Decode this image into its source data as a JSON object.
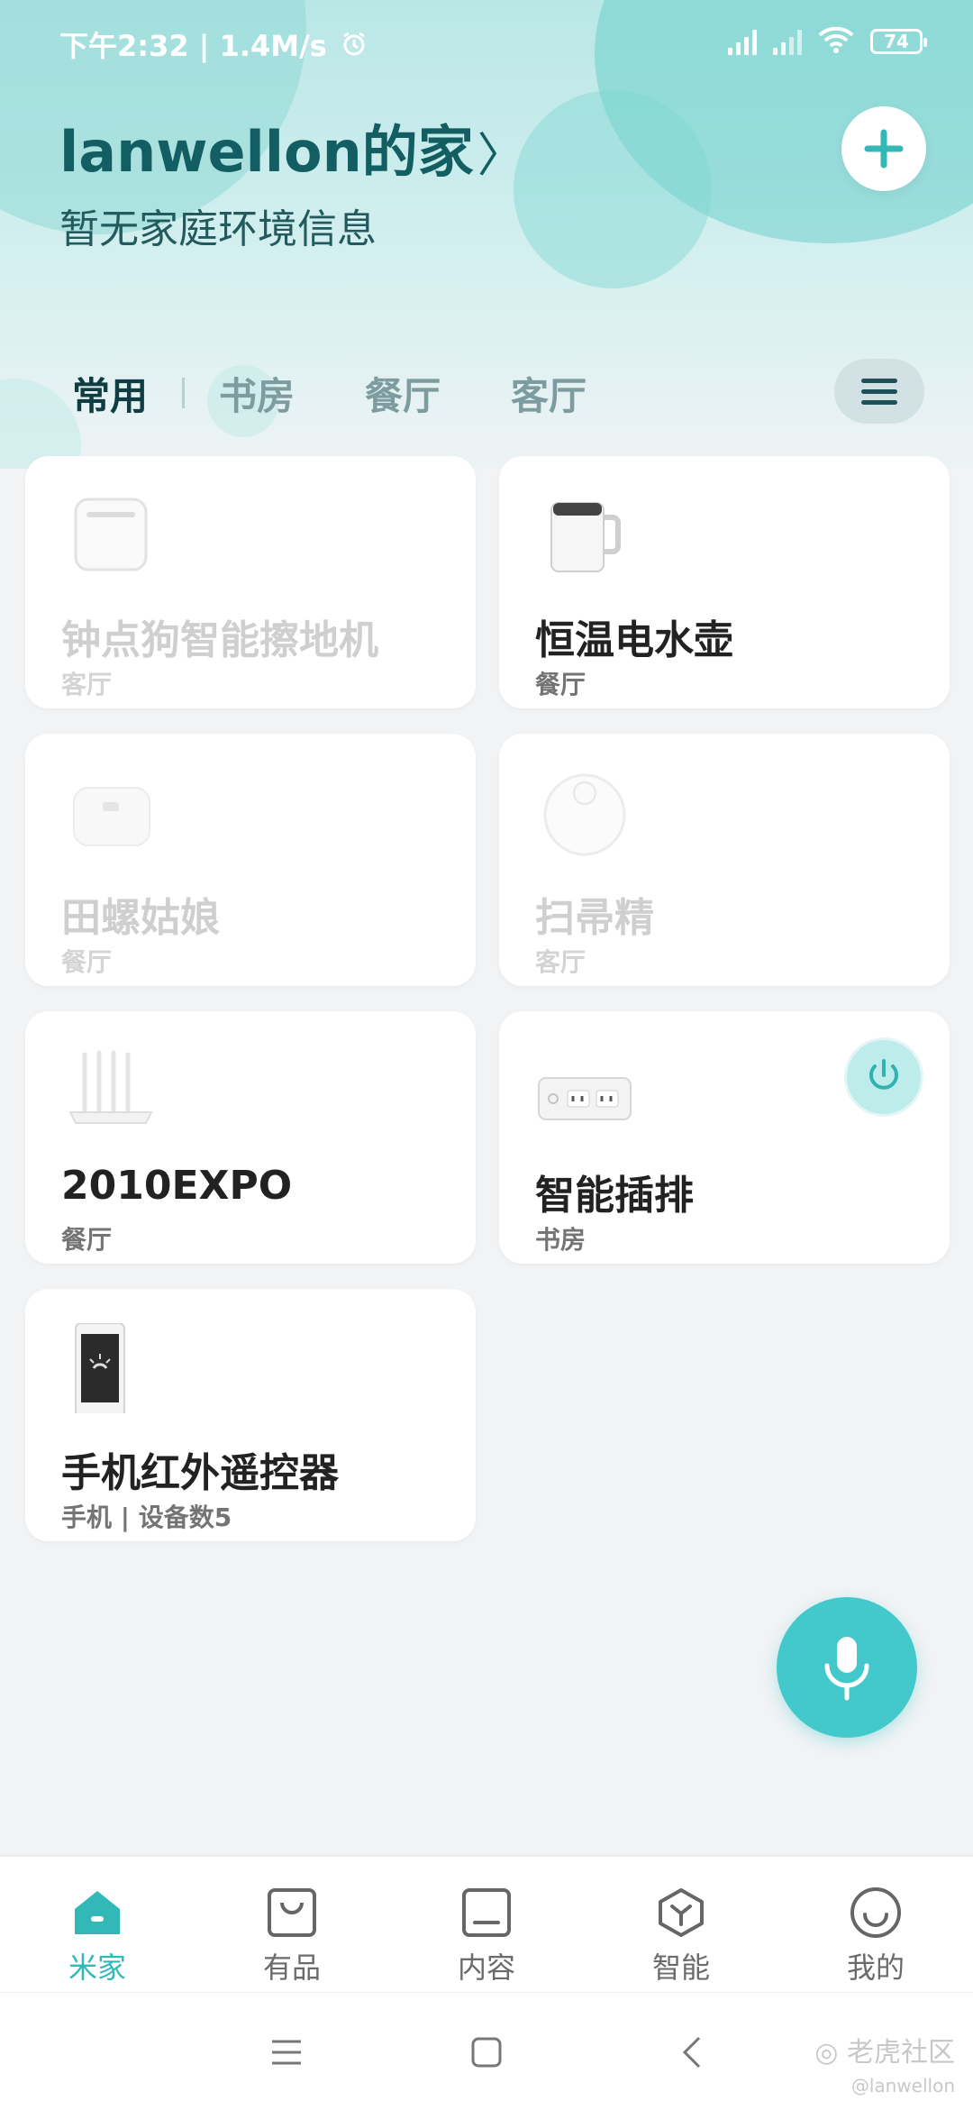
{
  "status_bar": {
    "time_speed": "下午2:32 | 1.4M/s",
    "battery": "74"
  },
  "header": {
    "home_name": "lanwellon的家",
    "chevron": "〉",
    "subtitle": "暂无家庭环境信息"
  },
  "tabs": [
    {
      "label": "常用",
      "active": true
    },
    {
      "label": "书房",
      "active": false
    },
    {
      "label": "餐厅",
      "active": false
    },
    {
      "label": "客厅",
      "active": false
    }
  ],
  "devices": [
    {
      "name": "钟点狗智能擦地机",
      "room": "客厅",
      "online": false,
      "icon": "mop-robot-icon"
    },
    {
      "name": "恒温电水壶",
      "room": "餐厅",
      "online": true,
      "icon": "kettle-icon"
    },
    {
      "name": "田螺姑娘",
      "room": "餐厅",
      "online": false,
      "icon": "rice-cooker-icon"
    },
    {
      "name": "扫帚精",
      "room": "客厅",
      "online": false,
      "icon": "robot-vacuum-icon"
    },
    {
      "name": "2010EXPO",
      "room": "餐厅",
      "online": true,
      "icon": "router-icon"
    },
    {
      "name": "智能插排",
      "room": "书房",
      "online": true,
      "icon": "power-strip-icon"
    },
    {
      "name": "手机红外遥控器",
      "room": "手机 | 设备数5",
      "online": true,
      "icon": "phone-remote-icon"
    }
  ],
  "bottom_nav": [
    {
      "label": "米家",
      "icon": "home-icon",
      "active": true
    },
    {
      "label": "有品",
      "icon": "shopping-bag-icon",
      "active": false
    },
    {
      "label": "内容",
      "icon": "content-icon",
      "active": false
    },
    {
      "label": "智能",
      "icon": "smart-cube-icon",
      "active": false
    },
    {
      "label": "我的",
      "icon": "profile-smile-icon",
      "active": false
    }
  ],
  "watermark": {
    "text": "老虎社区",
    "sub": "@lanwellon"
  },
  "colors": {
    "accent": "#43c9cb",
    "title": "#125e62",
    "nav_active": "#33b8b8"
  }
}
